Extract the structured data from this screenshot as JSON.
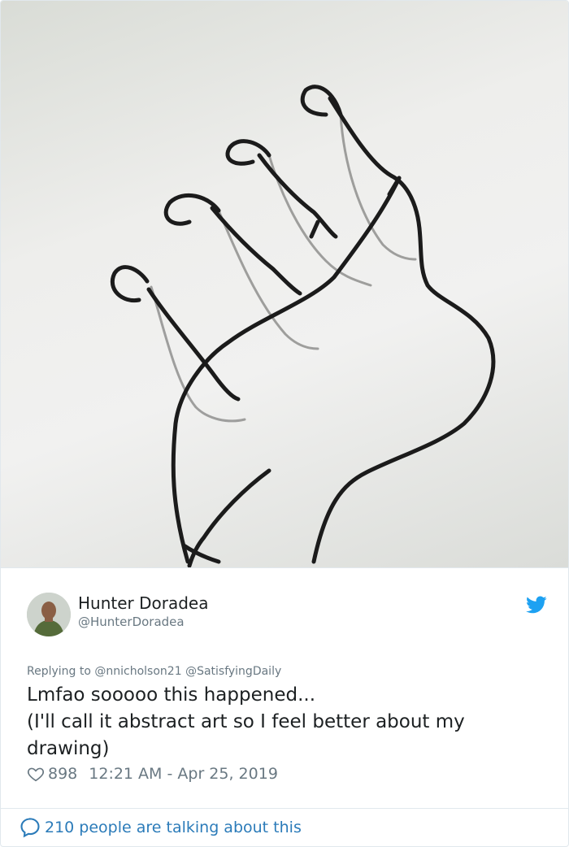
{
  "tweet": {
    "author": {
      "display_name": "Hunter Doradea",
      "handle": "@HunterDoradea"
    },
    "replying_prefix": "Replying to",
    "reply_to": [
      "@nnicholson21",
      "@SatisfyingDaily"
    ],
    "text": "Lmfao sooooo this happened...\n(I'll call it abstract art so I feel better about my drawing)",
    "likes": "898",
    "timestamp": "12:21 AM - Apr 25, 2019",
    "footer_text": "210 people are talking about this"
  },
  "colors": {
    "link_blue": "#2b7bb9",
    "twitter_blue": "#1da1f2",
    "meta_gray": "#697882",
    "text_dark": "#1c2022"
  },
  "icons": [
    "twitter-bird-icon",
    "heart-icon",
    "speech-bubble-icon"
  ]
}
